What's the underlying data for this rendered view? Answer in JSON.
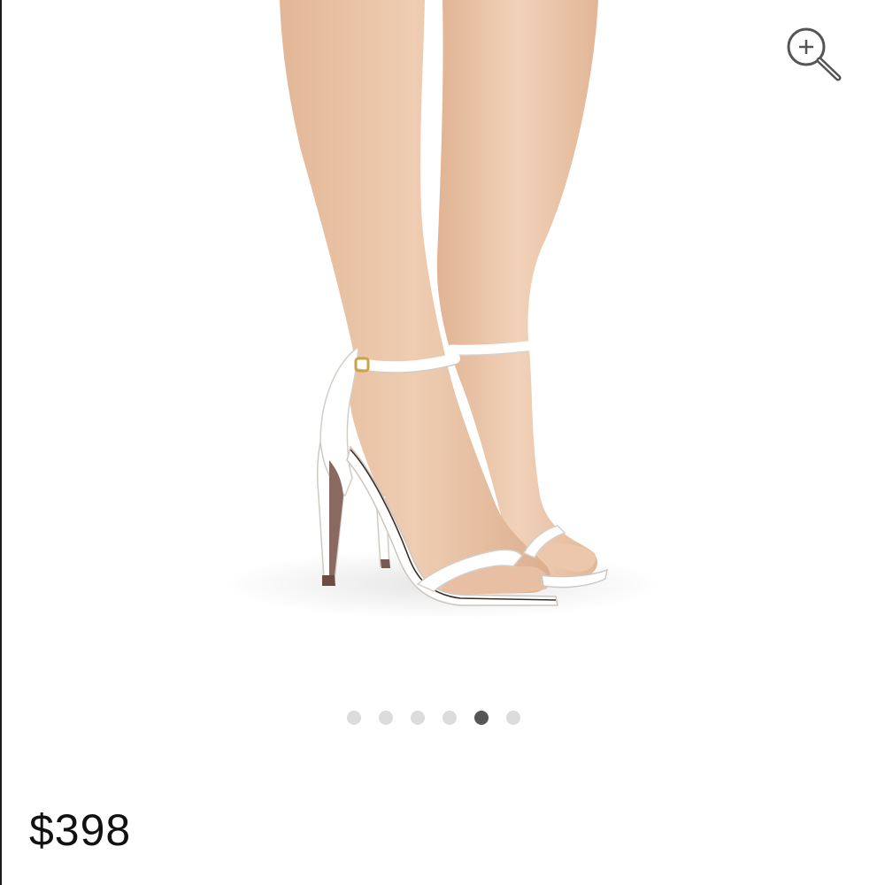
{
  "product": {
    "price": "$398",
    "image_subject": "white-ankle-strap-heeled-sandal",
    "sandal_color": "#ffffff",
    "heel_sole_color": "#8a6a60"
  },
  "carousel": {
    "total": 6,
    "active_index": 4
  },
  "icons": {
    "zoom": "zoom-in-icon"
  },
  "colors": {
    "dot_inactive": "#dcdcdc",
    "dot_active": "#555555",
    "skin": "#e9c3a6"
  }
}
